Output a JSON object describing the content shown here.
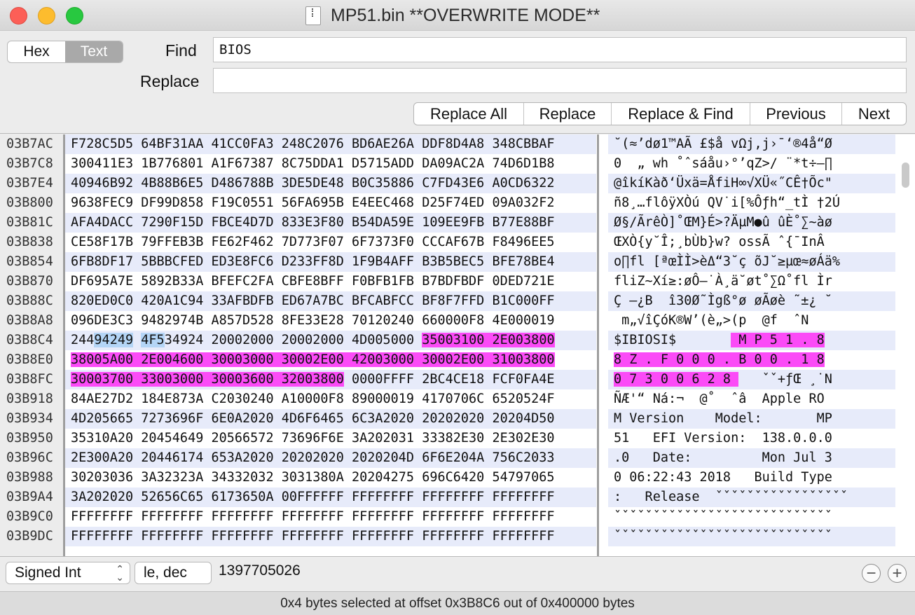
{
  "window": {
    "title": "MP51.bin **OVERWRITE MODE**"
  },
  "toolbar": {
    "mode_hex": "Hex",
    "mode_text": "Text",
    "find_label": "Find",
    "find_value": "BIOS",
    "replace_label": "Replace",
    "replace_value": "",
    "buttons": [
      "Replace All",
      "Replace",
      "Replace & Find",
      "Previous",
      "Next"
    ]
  },
  "offsets": [
    "03B7AC",
    "03B7C8",
    "03B7E4",
    "03B800",
    "03B81C",
    "03B838",
    "03B854",
    "03B870",
    "03B88C",
    "03B8A8",
    "03B8C4",
    "03B8E0",
    "03B8FC",
    "03B918",
    "03B934",
    "03B950",
    "03B96C",
    "03B988",
    "03B9A4",
    "03B9C0",
    "03B9DC"
  ],
  "hex_rows": [
    "F728C5D5 64BF31AA 41CC0FA3 248C2076 BD6AE26A DDF8D4A8 348CBBAF",
    "300411E3 1B776801 A1F67387 8C75DDA1 D5715ADD DA09AC2A 74D6D1B8",
    "40946B92 4B88B6E5 D486788B 3DE5DE48 B0C35886 C7FD43E6 A0CD6322",
    "9638FEC9 DF99D858 F19C0551 56FA695B E4EEC468 D25F74ED 09A032F2",
    "AFA4DACC 7290F15D FBCE4D7D 833E3F80 B54DA59E 109EE9FB B77E88BF",
    "CE58F17B 79FFEB3B FE62F462 7D773F07 6F7373F0 CCCAF67B F8496EE5",
    "6FB8DF17 5BBBCFED ED3E8FC6 D233FF8D 1F9B4AFF B3B5BEC5 BFE78BE4",
    "DF695A7E 5892B33A BFEFC2FA CBFE8BFF F0BFB1FB B7BDFBDF 0DED721E",
    "820ED0C0 420A1C94 33AFBDFB ED67A7BC BFCABFCC BF8F7FFD B1C000FF",
    "096DE3C3 9482974B A857D528 8FE33E28 70120240 660000F8 4E000019",
    "24494249 4F534924 20002000 20002000 4D005000 35003100 2E003800",
    "38005A00 2E004600 30003000 30002E00 42003000 30002E00 31003800",
    "30003700 33003000 30003600 32003800 0000FFFF 2BC4CE18 FCF0FA4E",
    "84AE27D2 184E873A C2030240 A10000F8 89000019 4170706C 6520524F",
    "4D205665 7273696F 6E0A2020 4D6F6465 6C3A2020 20202020 20204D50",
    "35310A20 20454649 20566572 73696F6E 3A202031 33382E30 2E302E30",
    "2E300A20 20446174 653A2020 20202020 2020204D 6F6E204A 756C2033",
    "30203036 3A32323A 34332032 3031380A 20204275 696C6420 54797065",
    "3A202020 52656C65 6173650A 00FFFFFF FFFFFFFF FFFFFFFF FFFFFFFF",
    "FFFFFFFF FFFFFFFF FFFFFFFF FFFFFFFF FFFFFFFF FFFFFFFF FFFFFFFF",
    "FFFFFFFF FFFFFFFF FFFFFFFF FFFFFFFF FFFFFFFF FFFFFFFF FFFFFFFF"
  ],
  "text_rows": [
    "˘(≈’dø1™AÃ £$å vΩj,j›¯‘®4å“Ø",
    "0  „ wh ˚ˆsáåu›°’qZ>/ ¨*t÷–∏",
    "@îkíKàð‘Üxä=ÅfiH∞√XÜ«˝CÊ†Õc\"",
    "ñ8¸…flôÿXÒú QV˙i[%Ôƒh“_tÌ †2Ú",
    "Ø§/ÃrêÒ]˚ŒM}É>?ÄµM●û ûÈ˚∑~àø",
    "ŒXÒ{y˘Î;¸bÙb}w? ossÃ ˆ{¯InÂ",
    "o∏fl [ªœÌÌ>èΔ“3˘ç õJ˘≥µœ≈øÁä%",
    "fliZ~Xí≥:øÔ–˙À¸ä˘øt˚∑Ω˚fl Ìr",
    "Ç –¿B  î30Ø˜Ìgß°ø øÃøè ˜±¿ ˘",
    " m„√îÇóK®W’(è„>(p  @f  ˆN",
    "$IBIOSI$        M P 5 1 . 8",
    "8 Z . F 0 0 0 . B 0 0 . 1 8",
    "0 7 3 0 0 6 2 8    ˇˇ+ƒŒ ¸˙N",
    "ÑÆ'“ Ná:¬  @˚  ˆâ  Apple RO",
    "M Version    Model:       MP",
    "51   EFI Version:  138.0.0.0",
    ".0   Date:         Mon Jul 3",
    "0 06:22:43 2018   Build Type",
    ":   Release  ˇˇˇˇˇˇˇˇˇˇˇˇˇˇˇˇˇ",
    "ˇˇˇˇˇˇˇˇˇˇˇˇˇˇˇˇˇˇˇˇˇˇˇˇˇˇˇˇ",
    "ˇˇˇˇˇˇˇˇˇˇˇˇˇˇˇˇˇˇˇˇˇˇˇˇˇˇˇˇ"
  ],
  "bottom": {
    "type_select": "Signed Int",
    "endian_select": "le, dec",
    "value": "1397705026",
    "minus": "−",
    "plus": "+"
  },
  "status": "0x4 bytes selected at offset 0x3B8C6 out of 0x400000 bytes",
  "colors": {
    "highlight": "#fb4bf7",
    "selection": "#b4d5f6",
    "row_alt": "#e7ebfa"
  }
}
